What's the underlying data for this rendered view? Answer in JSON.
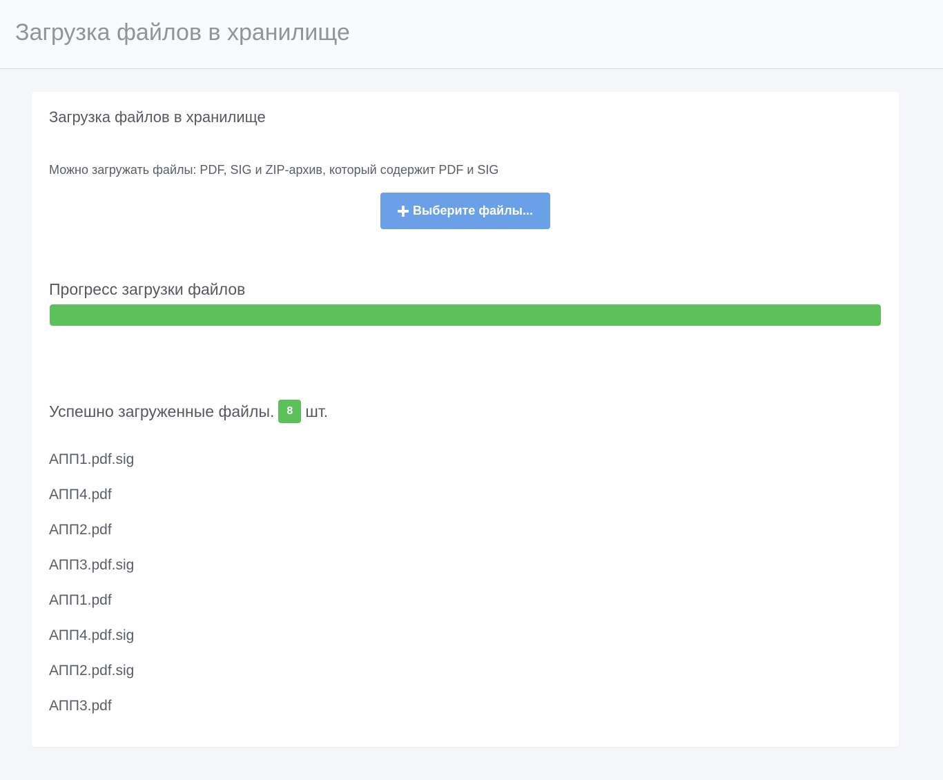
{
  "header": {
    "title": "Загрузка файлов в хранилище"
  },
  "card": {
    "title": "Загрузка файлов в хранилище",
    "hint": "Можно загружать файлы: PDF, SIG и ZIP-архив, который содержит PDF и SIG",
    "select_button": {
      "label": "Выберите файлы...",
      "icon": "plus-icon",
      "color": "#6aa0e8"
    },
    "progress": {
      "title": "Прогресс загрузки файлов",
      "percent": 100,
      "color": "#5ec05a"
    },
    "uploaded": {
      "title": "Успешно загруженные файлы.",
      "count": "8",
      "unit": "шт.",
      "badge_color": "#5cc05a",
      "files": [
        "АПП1.pdf.sig",
        "АПП4.pdf",
        "АПП2.pdf",
        "АПП3.pdf.sig",
        "АПП1.pdf",
        "АПП4.pdf.sig",
        "АПП2.pdf.sig",
        "АПП3.pdf"
      ]
    }
  }
}
